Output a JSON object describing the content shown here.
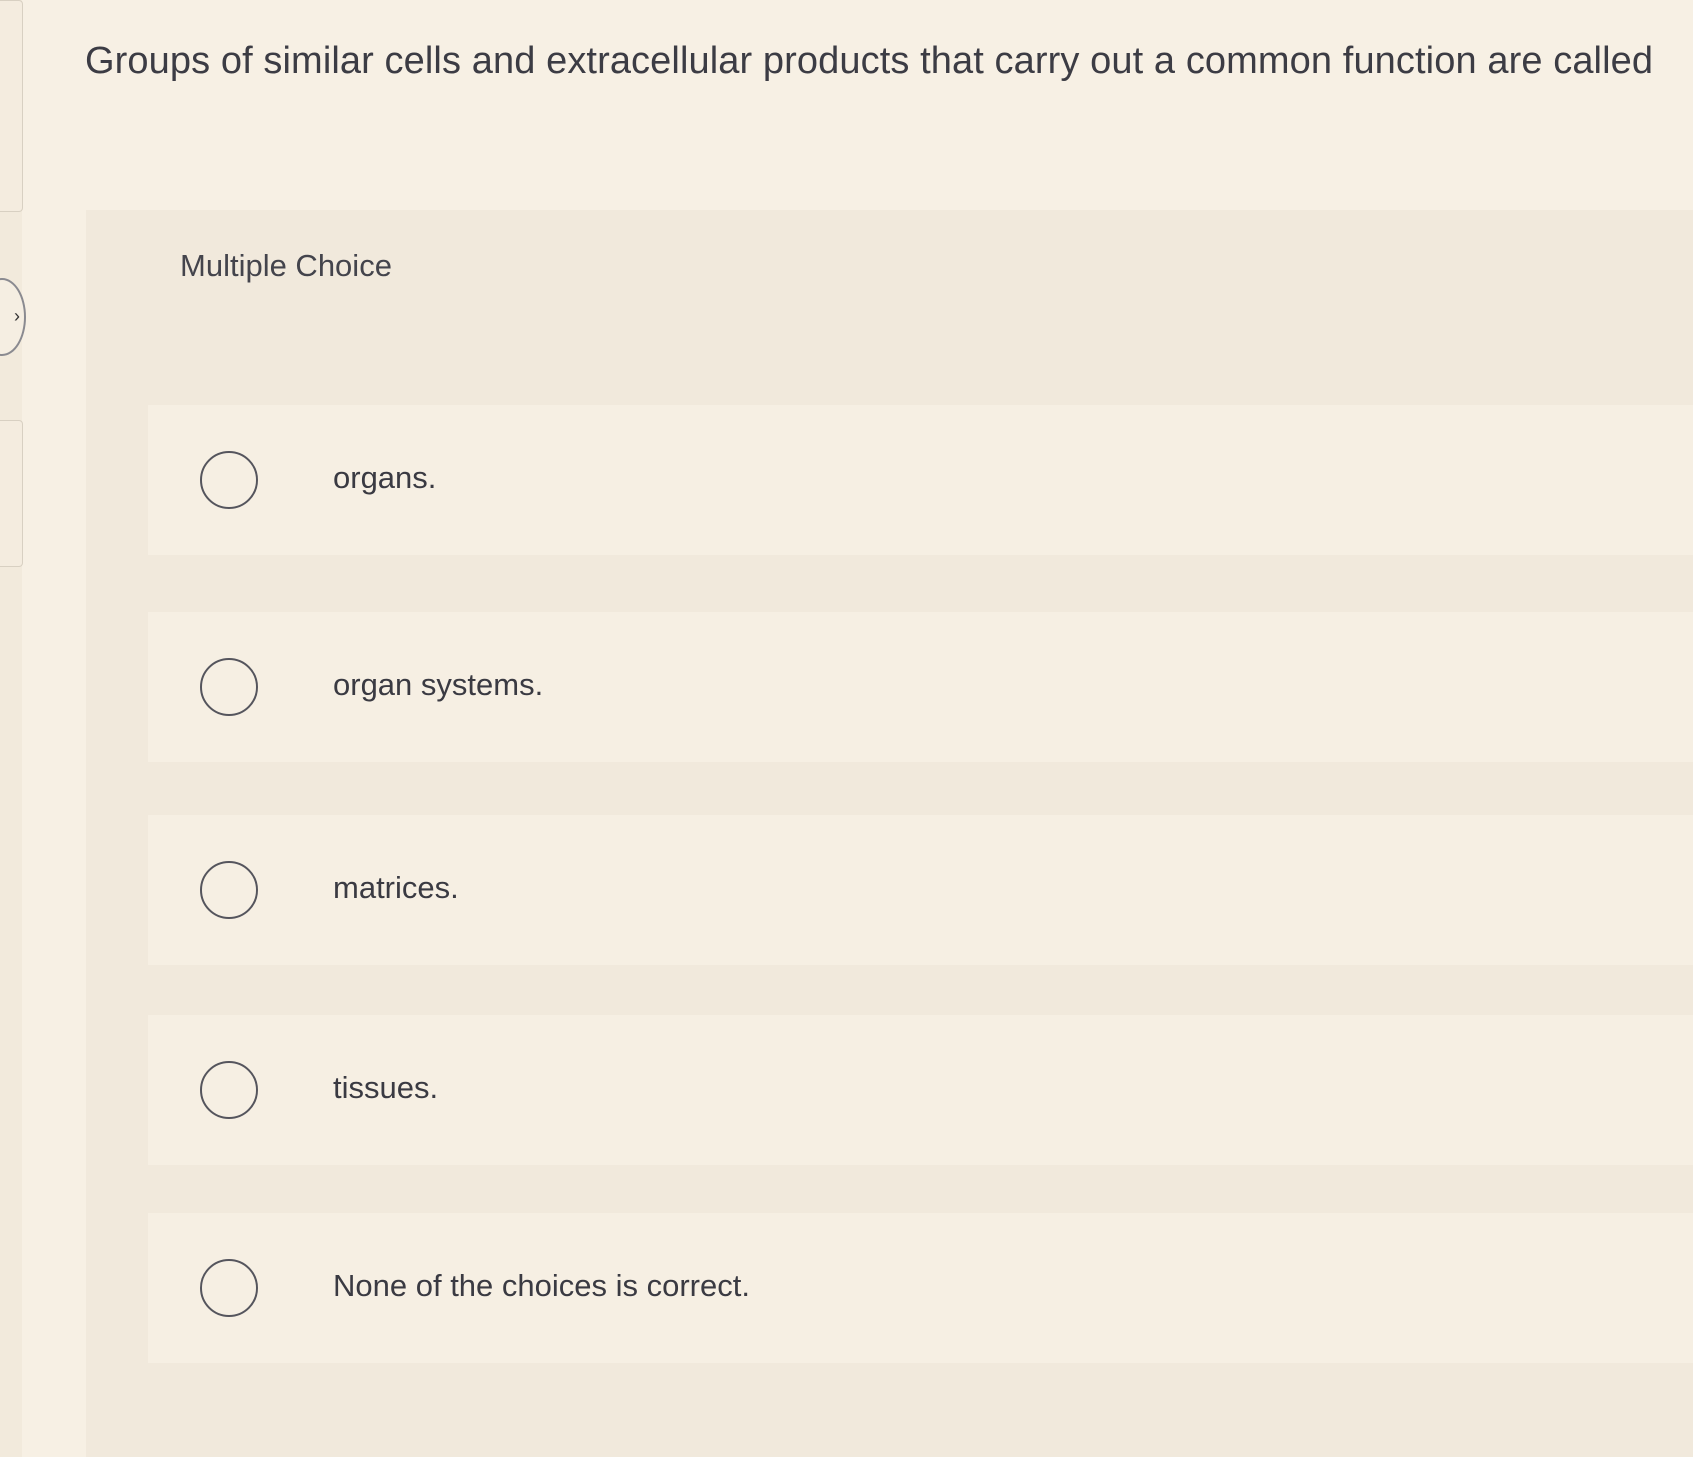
{
  "question": {
    "text": "Groups of similar cells and extracellular products that carry out a common function are called"
  },
  "panel": {
    "label": "Multiple Choice"
  },
  "options": [
    {
      "label": "organs."
    },
    {
      "label": "organ systems."
    },
    {
      "label": "matrices."
    },
    {
      "label": "tissues."
    },
    {
      "label": "None of the choices is correct."
    }
  ],
  "colors": {
    "background": "#f7f0e4",
    "panel": "#f1e9dc",
    "option": "#f6efe3",
    "text": "#3a3a42",
    "radio_border": "#55555d"
  }
}
